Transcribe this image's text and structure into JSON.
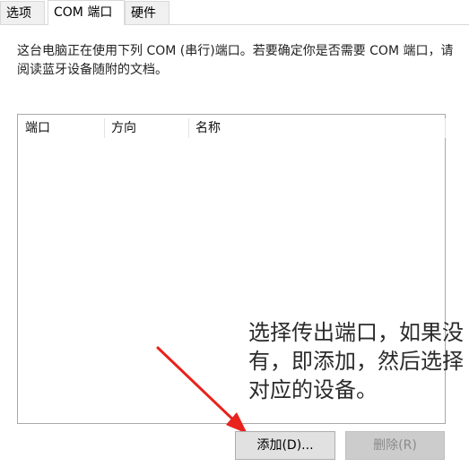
{
  "tabs": [
    {
      "label": "选项"
    },
    {
      "label": "COM 端口"
    },
    {
      "label": "硬件"
    }
  ],
  "description": "这台电脑正在使用下列 COM (串行)端口。若要确定你是否需要 COM 端口，请阅读蓝牙设备随附的文档。",
  "list": {
    "columns": [
      "端口",
      "方向",
      "名称"
    ]
  },
  "buttons": {
    "add": "添加(D)...",
    "remove": "删除(R)"
  },
  "annotation": "选择传出端口，如果没有，即添加，然后选择对应的设备。",
  "colors": {
    "arrow": "#e8231b",
    "tab_border": "#d9d9d9",
    "listbox_border": "#a9a9a9"
  }
}
